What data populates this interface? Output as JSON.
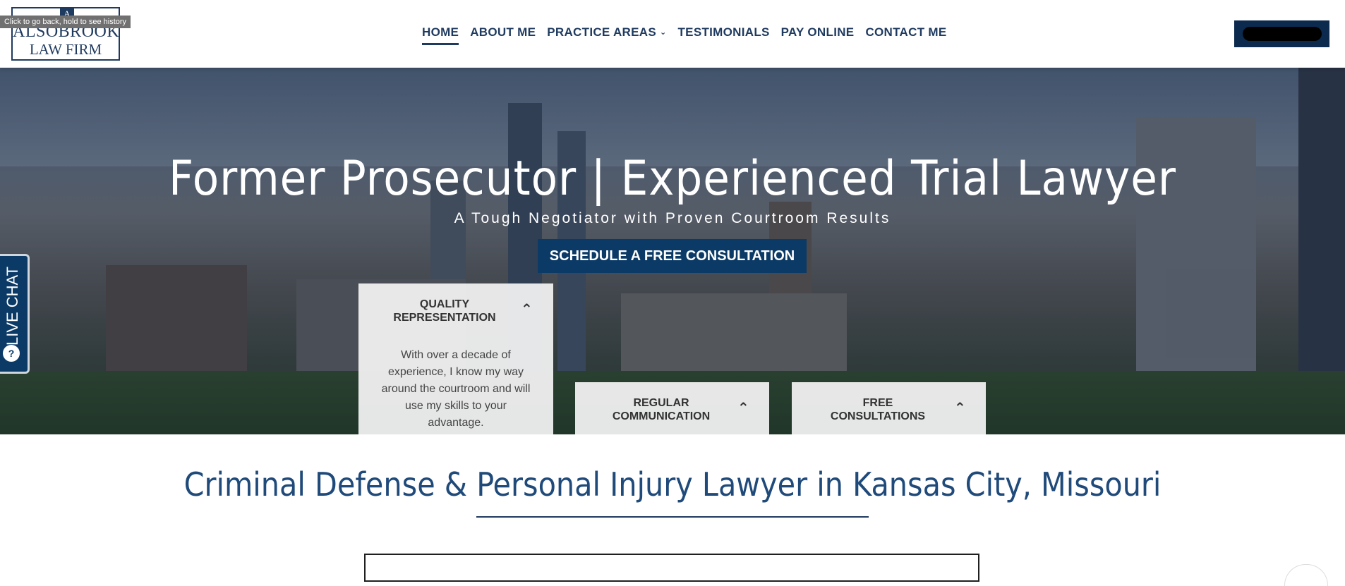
{
  "tooltip": "Click to go back, hold to see history",
  "logo": {
    "mark": "A",
    "line1": "ALSOBROOK",
    "line2": "LAW FIRM"
  },
  "nav": {
    "home": "HOME",
    "about": "ABOUT ME",
    "practice": "PRACTICE AREAS",
    "testimonials": "TESTIMONIALS",
    "pay": "PAY ONLINE",
    "contact": "CONTACT ME"
  },
  "hero": {
    "title": "Former Prosecutor | Experienced Trial Lawyer",
    "subtitle": "A Tough Negotiator with Proven Courtroom Results",
    "cta": "SCHEDULE A FREE CONSULTATION"
  },
  "cards": [
    {
      "title_line1": "QUALITY",
      "title_line2": "REPRESENTATION",
      "body": "With over a decade of experience, I know my way around the courtroom and will use my skills to your advantage."
    },
    {
      "title_line1": "REGULAR",
      "title_line2": "COMMUNICATION"
    },
    {
      "title_line1": "FREE",
      "title_line2": "CONSULTATIONS"
    }
  ],
  "livechat": {
    "label": "LIVE CHAT",
    "icon": "chat-bubble-icon"
  },
  "section": {
    "title": "Criminal Defense & Personal Injury Lawyer in Kansas City, Missouri"
  },
  "colors": {
    "navy": "#1f3a5f",
    "cta": "#0b3a66",
    "heading": "#1f4a7a"
  }
}
